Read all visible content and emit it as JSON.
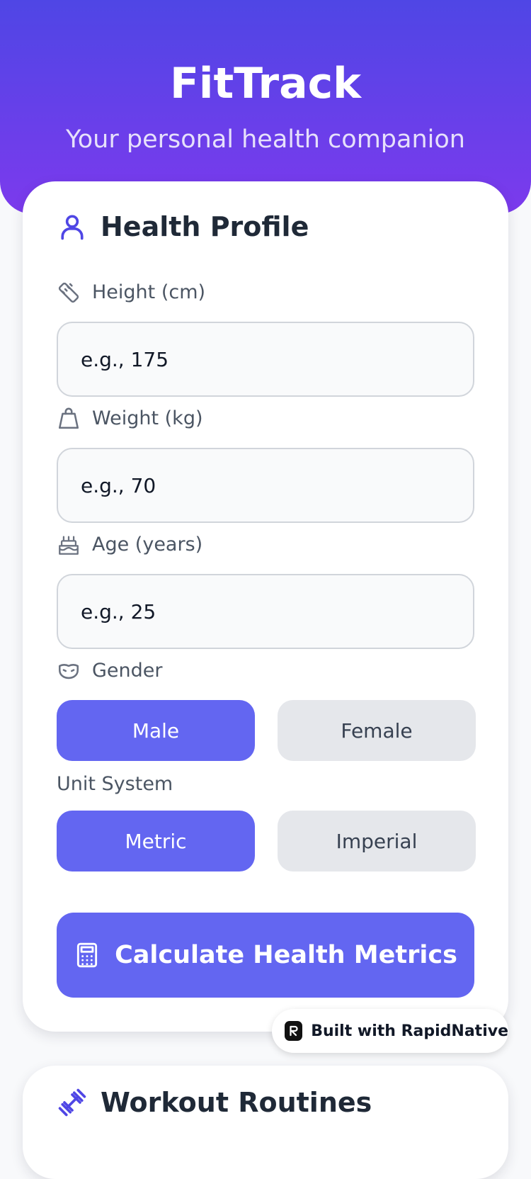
{
  "header": {
    "title": "FitTrack",
    "subtitle": "Your personal health companion"
  },
  "colors": {
    "accent": "#6366f1",
    "header_gradient_start": "#4f46e5",
    "header_gradient_end": "#7c3aed",
    "inactive_button": "#e5e7eb"
  },
  "health_profile": {
    "title": "Health Profile",
    "icon": "user-icon",
    "fields": {
      "height": {
        "label": "Height (cm)",
        "placeholder": "e.g., 175",
        "value": "",
        "icon": "ruler-icon"
      },
      "weight": {
        "label": "Weight (kg)",
        "placeholder": "e.g., 70",
        "value": "",
        "icon": "weight-icon"
      },
      "age": {
        "label": "Age (years)",
        "placeholder": "e.g., 25",
        "value": "",
        "icon": "cake-icon"
      }
    },
    "gender": {
      "label": "Gender",
      "icon": "mask-icon",
      "options": [
        "Male",
        "Female"
      ],
      "selected": "Male"
    },
    "unit_system": {
      "label": "Unit System",
      "options": [
        "Metric",
        "Imperial"
      ],
      "selected": "Metric"
    },
    "calculate_button": {
      "label": "Calculate Health Metrics",
      "icon": "calculator-icon"
    }
  },
  "badge": {
    "label": "Built with RapidNative"
  },
  "workout_routines": {
    "title": "Workout Routines",
    "icon": "dumbbell-icon"
  }
}
